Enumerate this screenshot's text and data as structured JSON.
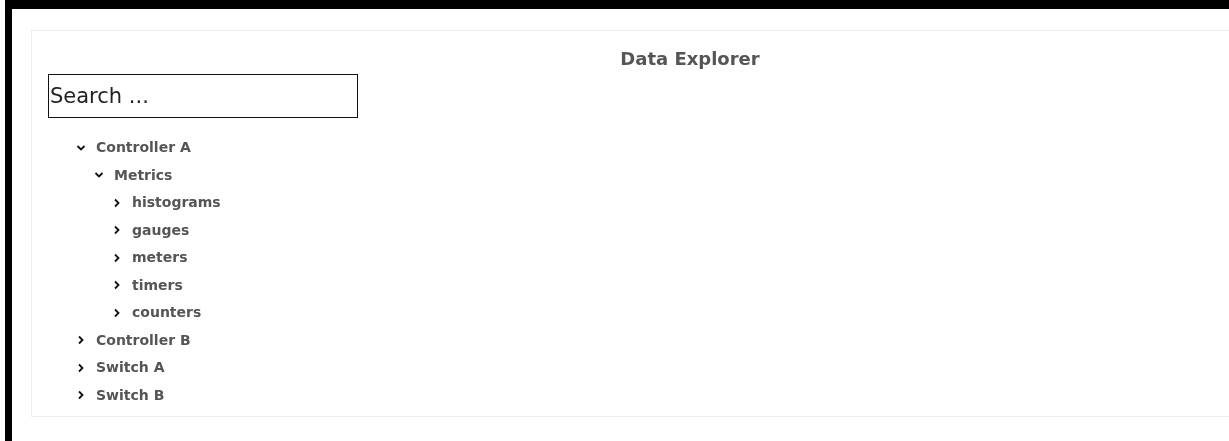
{
  "title": "Data Explorer",
  "search": {
    "placeholder": "Search ..."
  },
  "tree": [
    {
      "label": "Controller A",
      "expanded": true,
      "children": [
        {
          "label": "Metrics",
          "expanded": true,
          "children": [
            {
              "label": "histograms",
              "expanded": false
            },
            {
              "label": "gauges",
              "expanded": false
            },
            {
              "label": "meters",
              "expanded": false
            },
            {
              "label": "timers",
              "expanded": false
            },
            {
              "label": "counters",
              "expanded": false
            }
          ]
        }
      ]
    },
    {
      "label": "Controller B",
      "expanded": false
    },
    {
      "label": "Switch A",
      "expanded": false
    },
    {
      "label": "Switch B",
      "expanded": false
    }
  ]
}
